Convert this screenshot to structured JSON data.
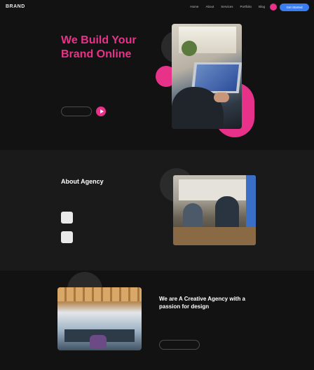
{
  "header": {
    "logo": "BRAND",
    "nav": [
      "Home",
      "About",
      "Services",
      "Portfolio",
      "Blog"
    ],
    "cta_label": "Get Started"
  },
  "hero": {
    "title": "We Build Your Brand Online",
    "text": "",
    "primary_button": "",
    "play_label": ""
  },
  "about": {
    "eyebrow": "",
    "title": "About Agency",
    "text": "",
    "features": [
      {
        "title": "",
        "desc": ""
      },
      {
        "title": "",
        "desc": ""
      }
    ]
  },
  "creative": {
    "eyebrow": "",
    "title": "We are A Creative Agency with a passion for design",
    "text": "",
    "button": ""
  },
  "colors": {
    "accent": "#e8328a",
    "cta": "#3a7df0",
    "background": "#121212",
    "section_alt": "#1a1a1a"
  }
}
